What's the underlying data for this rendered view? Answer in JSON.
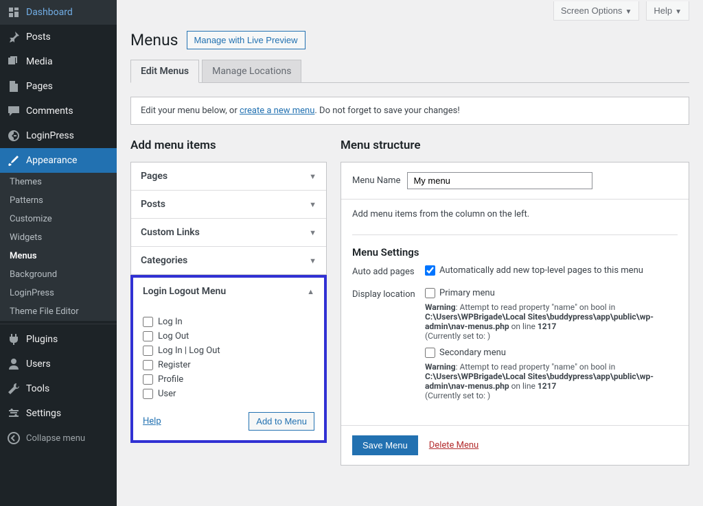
{
  "topbar": {
    "screen_options": "Screen Options",
    "help": "Help"
  },
  "header": {
    "title": "Menus",
    "live_preview": "Manage with Live Preview"
  },
  "tabs": {
    "edit": "Edit Menus",
    "locations": "Manage Locations"
  },
  "notice": {
    "pre": "Edit your menu below, or ",
    "link": "create a new menu",
    "post": ". Do not forget to save your changes!"
  },
  "sidebar": {
    "items": [
      "Dashboard",
      "Posts",
      "Media",
      "Pages",
      "Comments",
      "LoginPress",
      "Appearance",
      "Plugins",
      "Users",
      "Tools",
      "Settings"
    ],
    "sub": [
      "Themes",
      "Patterns",
      "Customize",
      "Widgets",
      "Menus",
      "Background",
      "LoginPress",
      "Theme File Editor"
    ],
    "collapse": "Collapse menu"
  },
  "left": {
    "title": "Add menu items",
    "accordion": [
      "Pages",
      "Posts",
      "Custom Links",
      "Categories",
      "Login Logout Menu"
    ],
    "login_items": [
      "Log In",
      "Log Out",
      "Log In | Log Out",
      "Register",
      "Profile",
      "User"
    ],
    "help": "Help",
    "add_to_menu": "Add to Menu"
  },
  "right": {
    "title": "Menu structure",
    "name_label": "Menu Name",
    "name_value": "My menu",
    "instructions": "Add menu items from the column on the left.",
    "settings_title": "Menu Settings",
    "auto_label": "Auto add pages",
    "auto_check": "Automatically add new top-level pages to this menu",
    "display_label": "Display location",
    "primary": "Primary menu",
    "secondary": "Secondary menu",
    "warn_pre": "Warning",
    "warn_body": ": Attempt to read property \"name\" on bool in ",
    "warn_path": "C:\\Users\\WPBrigade\\Local Sites\\buddypress\\app\\public\\wp-admin\\nav-menus.php",
    "warn_line_pre": " on line ",
    "warn_line": "1217",
    "warn_current": "(Currently set to: )",
    "save": "Save Menu",
    "delete": "Delete Menu"
  }
}
